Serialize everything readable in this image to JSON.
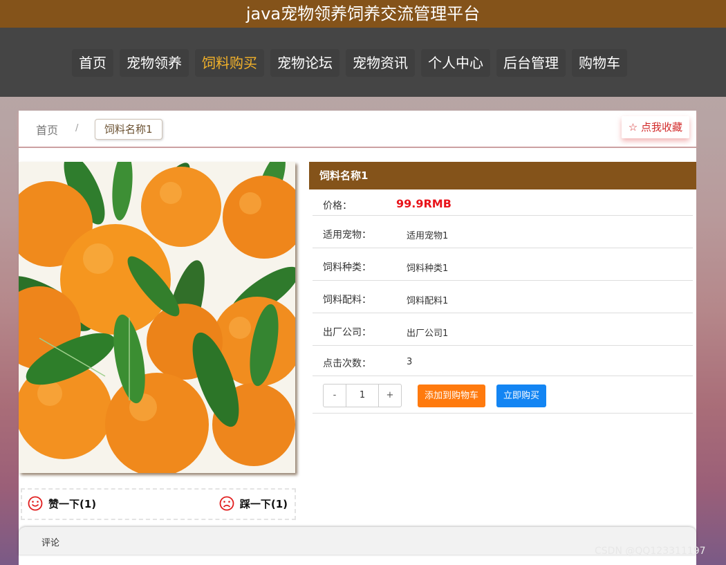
{
  "site": {
    "title": "java宠物领养饲养交流管理平台"
  },
  "nav": {
    "items": [
      {
        "label": "首页",
        "icon": "",
        "active": false
      },
      {
        "label": "宠物领养",
        "active": false
      },
      {
        "label": "饲料购买",
        "active": true
      },
      {
        "label": "宠物论坛",
        "active": false
      },
      {
        "label": "宠物资讯",
        "active": false
      },
      {
        "label": "个人中心",
        "active": false
      },
      {
        "label": "后台管理",
        "active": false
      },
      {
        "label": "购物车",
        "active": false
      }
    ]
  },
  "breadcrumb": {
    "home": "首页",
    "separator": "/",
    "current": "饲料名称1"
  },
  "favorite": {
    "icon": "star-outline-icon",
    "label": "☆ 点我收藏"
  },
  "product": {
    "image_description": "mandarin-oranges-with-leaves",
    "title": "饲料名称1",
    "price_label": "价格：",
    "price_value": "99.9RMB",
    "rows": [
      {
        "label": "适用宠物：",
        "value": "适用宠物1"
      },
      {
        "label": "饲料种类：",
        "value": "饲料种类1"
      },
      {
        "label": "饲料配料：",
        "value": "饲料配料1"
      },
      {
        "label": "出厂公司：",
        "value": "出厂公司1"
      }
    ],
    "clicks_label": "点击次数：",
    "clicks_value": "3"
  },
  "quantity": {
    "minus": "-",
    "value": "1",
    "plus": "+"
  },
  "actions": {
    "add_to_cart": "添加到购物车",
    "buy_now": "立即购买"
  },
  "votes": {
    "like_label": "赞一下(1)",
    "dislike_label": "踩一下(1)"
  },
  "comments": {
    "tab_label": "评论"
  },
  "watermark": {
    "text": "CSDN @QQ123311197"
  },
  "colors": {
    "brand_brown": "#84531a",
    "nav_bg": "#454545",
    "nav_active": "#f5b32a",
    "price_red": "#e8141b",
    "cart_orange": "#ff7a0e",
    "buy_blue": "#1385f3",
    "favorite_red": "#d22a2a"
  }
}
